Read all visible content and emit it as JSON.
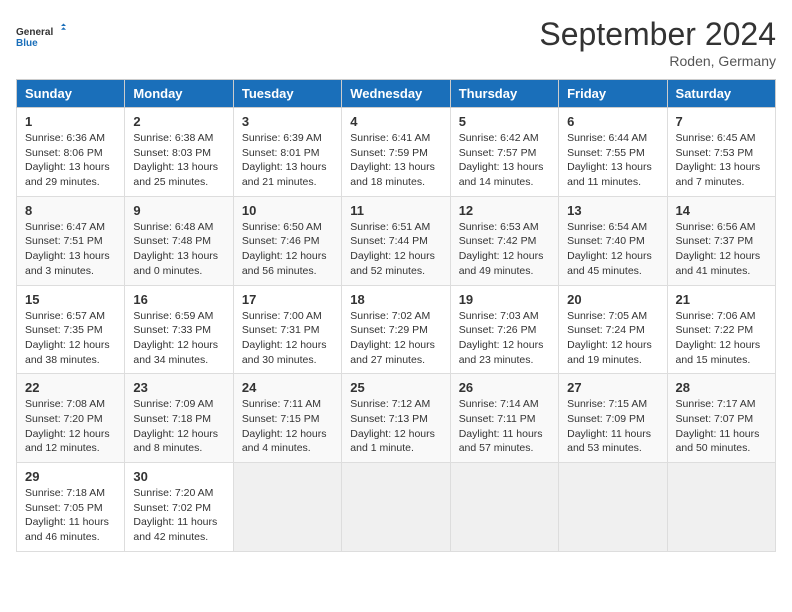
{
  "header": {
    "logo_line1": "General",
    "logo_line2": "Blue",
    "month": "September 2024",
    "location": "Roden, Germany"
  },
  "days_of_week": [
    "Sunday",
    "Monday",
    "Tuesday",
    "Wednesday",
    "Thursday",
    "Friday",
    "Saturday"
  ],
  "weeks": [
    [
      {
        "day": "1",
        "text": "Sunrise: 6:36 AM\nSunset: 8:06 PM\nDaylight: 13 hours and 29 minutes."
      },
      {
        "day": "2",
        "text": "Sunrise: 6:38 AM\nSunset: 8:03 PM\nDaylight: 13 hours and 25 minutes."
      },
      {
        "day": "3",
        "text": "Sunrise: 6:39 AM\nSunset: 8:01 PM\nDaylight: 13 hours and 21 minutes."
      },
      {
        "day": "4",
        "text": "Sunrise: 6:41 AM\nSunset: 7:59 PM\nDaylight: 13 hours and 18 minutes."
      },
      {
        "day": "5",
        "text": "Sunrise: 6:42 AM\nSunset: 7:57 PM\nDaylight: 13 hours and 14 minutes."
      },
      {
        "day": "6",
        "text": "Sunrise: 6:44 AM\nSunset: 7:55 PM\nDaylight: 13 hours and 11 minutes."
      },
      {
        "day": "7",
        "text": "Sunrise: 6:45 AM\nSunset: 7:53 PM\nDaylight: 13 hours and 7 minutes."
      }
    ],
    [
      {
        "day": "8",
        "text": "Sunrise: 6:47 AM\nSunset: 7:51 PM\nDaylight: 13 hours and 3 minutes."
      },
      {
        "day": "9",
        "text": "Sunrise: 6:48 AM\nSunset: 7:48 PM\nDaylight: 13 hours and 0 minutes."
      },
      {
        "day": "10",
        "text": "Sunrise: 6:50 AM\nSunset: 7:46 PM\nDaylight: 12 hours and 56 minutes."
      },
      {
        "day": "11",
        "text": "Sunrise: 6:51 AM\nSunset: 7:44 PM\nDaylight: 12 hours and 52 minutes."
      },
      {
        "day": "12",
        "text": "Sunrise: 6:53 AM\nSunset: 7:42 PM\nDaylight: 12 hours and 49 minutes."
      },
      {
        "day": "13",
        "text": "Sunrise: 6:54 AM\nSunset: 7:40 PM\nDaylight: 12 hours and 45 minutes."
      },
      {
        "day": "14",
        "text": "Sunrise: 6:56 AM\nSunset: 7:37 PM\nDaylight: 12 hours and 41 minutes."
      }
    ],
    [
      {
        "day": "15",
        "text": "Sunrise: 6:57 AM\nSunset: 7:35 PM\nDaylight: 12 hours and 38 minutes."
      },
      {
        "day": "16",
        "text": "Sunrise: 6:59 AM\nSunset: 7:33 PM\nDaylight: 12 hours and 34 minutes."
      },
      {
        "day": "17",
        "text": "Sunrise: 7:00 AM\nSunset: 7:31 PM\nDaylight: 12 hours and 30 minutes."
      },
      {
        "day": "18",
        "text": "Sunrise: 7:02 AM\nSunset: 7:29 PM\nDaylight: 12 hours and 27 minutes."
      },
      {
        "day": "19",
        "text": "Sunrise: 7:03 AM\nSunset: 7:26 PM\nDaylight: 12 hours and 23 minutes."
      },
      {
        "day": "20",
        "text": "Sunrise: 7:05 AM\nSunset: 7:24 PM\nDaylight: 12 hours and 19 minutes."
      },
      {
        "day": "21",
        "text": "Sunrise: 7:06 AM\nSunset: 7:22 PM\nDaylight: 12 hours and 15 minutes."
      }
    ],
    [
      {
        "day": "22",
        "text": "Sunrise: 7:08 AM\nSunset: 7:20 PM\nDaylight: 12 hours and 12 minutes."
      },
      {
        "day": "23",
        "text": "Sunrise: 7:09 AM\nSunset: 7:18 PM\nDaylight: 12 hours and 8 minutes."
      },
      {
        "day": "24",
        "text": "Sunrise: 7:11 AM\nSunset: 7:15 PM\nDaylight: 12 hours and 4 minutes."
      },
      {
        "day": "25",
        "text": "Sunrise: 7:12 AM\nSunset: 7:13 PM\nDaylight: 12 hours and 1 minute."
      },
      {
        "day": "26",
        "text": "Sunrise: 7:14 AM\nSunset: 7:11 PM\nDaylight: 11 hours and 57 minutes."
      },
      {
        "day": "27",
        "text": "Sunrise: 7:15 AM\nSunset: 7:09 PM\nDaylight: 11 hours and 53 minutes."
      },
      {
        "day": "28",
        "text": "Sunrise: 7:17 AM\nSunset: 7:07 PM\nDaylight: 11 hours and 50 minutes."
      }
    ],
    [
      {
        "day": "29",
        "text": "Sunrise: 7:18 AM\nSunset: 7:05 PM\nDaylight: 11 hours and 46 minutes."
      },
      {
        "day": "30",
        "text": "Sunrise: 7:20 AM\nSunset: 7:02 PM\nDaylight: 11 hours and 42 minutes."
      },
      {
        "day": "",
        "text": ""
      },
      {
        "day": "",
        "text": ""
      },
      {
        "day": "",
        "text": ""
      },
      {
        "day": "",
        "text": ""
      },
      {
        "day": "",
        "text": ""
      }
    ]
  ]
}
